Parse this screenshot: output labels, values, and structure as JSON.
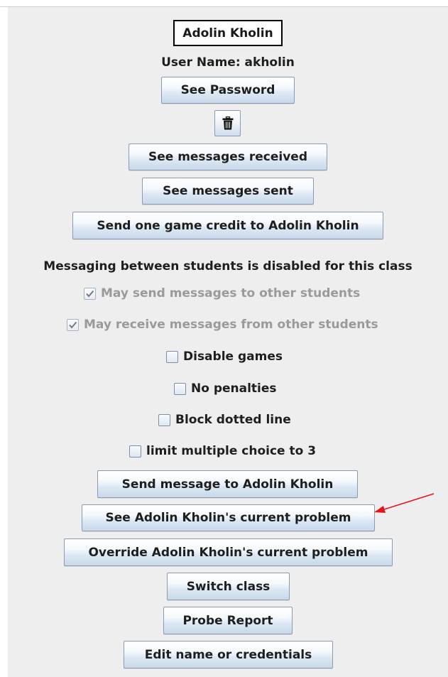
{
  "student": {
    "full_name": "Adolin Kholin",
    "user_name_label": "User Name: akholin"
  },
  "buttons": {
    "see_password": "See Password",
    "delete_icon": "trash-icon",
    "messages_received": "See messages received",
    "messages_sent": "See messages sent",
    "send_game_credit": "Send one game credit to Adolin Kholin",
    "send_message": "Send message to Adolin Kholin",
    "see_current_problem": "See Adolin Kholin's current problem",
    "override_current_problem": "Override Adolin Kholin's current problem",
    "switch_class": "Switch class",
    "probe_report": "Probe Report",
    "edit_credentials": "Edit name or credentials"
  },
  "messaging": {
    "notice": "Messaging between students is disabled for this class",
    "may_send": {
      "label": "May send messages to other students",
      "checked": true,
      "enabled": false
    },
    "may_receive": {
      "label": "May receive messages from other students",
      "checked": true,
      "enabled": false
    }
  },
  "options": {
    "disable_games": {
      "label": "Disable games",
      "checked": false
    },
    "no_penalties": {
      "label": "No penalties",
      "checked": false
    },
    "block_dotted_line": {
      "label": "Block dotted line",
      "checked": false
    },
    "limit_multiple_choice": {
      "label": "limit multiple choice to 3",
      "checked": false
    }
  },
  "annotation": {
    "arrow_color": "#e8131b"
  }
}
